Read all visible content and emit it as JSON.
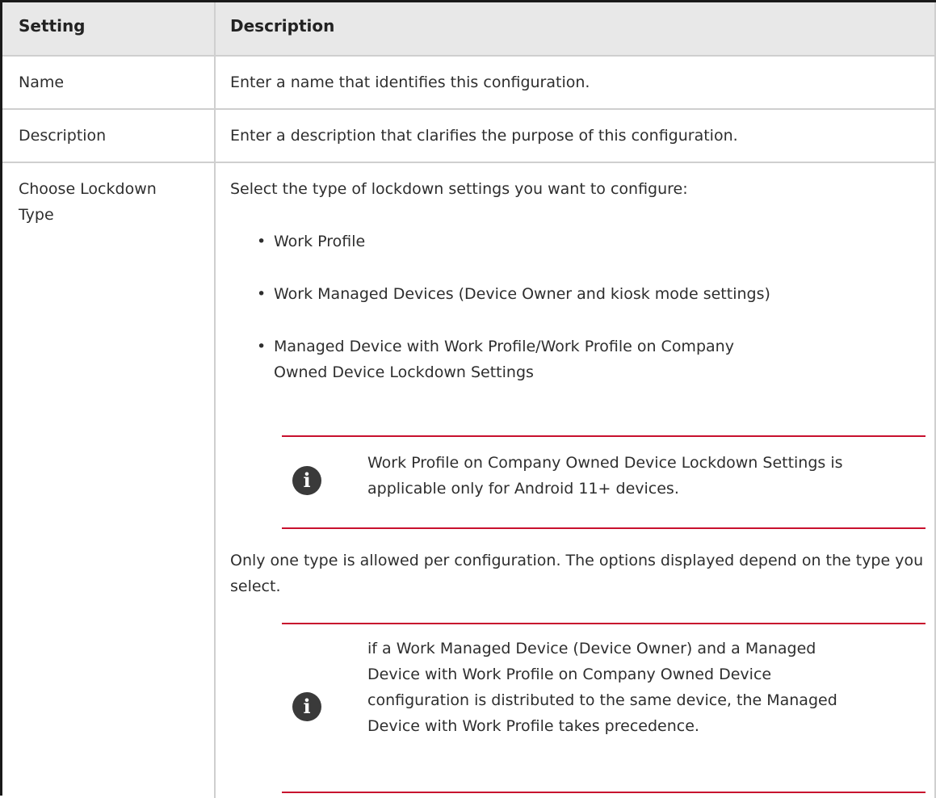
{
  "headers": {
    "setting": "Setting",
    "description": "Description"
  },
  "rows": [
    {
      "setting": "Name",
      "description": "Enter a name that identifies this configuration."
    },
    {
      "setting": "Description",
      "description": "Enter a description that clarifies the purpose of this configuration."
    },
    {
      "setting": "Choose Lockdown Type",
      "intro": "Select the type of lockdown settings you want to configure:",
      "bullets": [
        "Work Profile",
        "Work Managed Devices (Device Owner and kiosk mode settings)",
        "Managed Device with Work Profile/Work Profile on Company Owned Device Lockdown Settings"
      ],
      "note1": "Work Profile on Company Owned Device Lockdown Settings is applicable only for Android 11+ devices.",
      "paragraph": "Only one type is allowed per configuration. The options displayed depend on the type you select.",
      "note2": "if a Work Managed Device (Device Owner) and a Managed Device with Work Profile on Company Owned Device configuration is distributed to the same device, the Managed Device with Work Profile takes precedence."
    }
  ],
  "icons": {
    "note_icon": "info-icon",
    "note_glyph": "i"
  },
  "colors": {
    "note_rule": "#c8102e",
    "header_bg": "#e8e8e8",
    "icon_bg": "#3a3a3a"
  }
}
